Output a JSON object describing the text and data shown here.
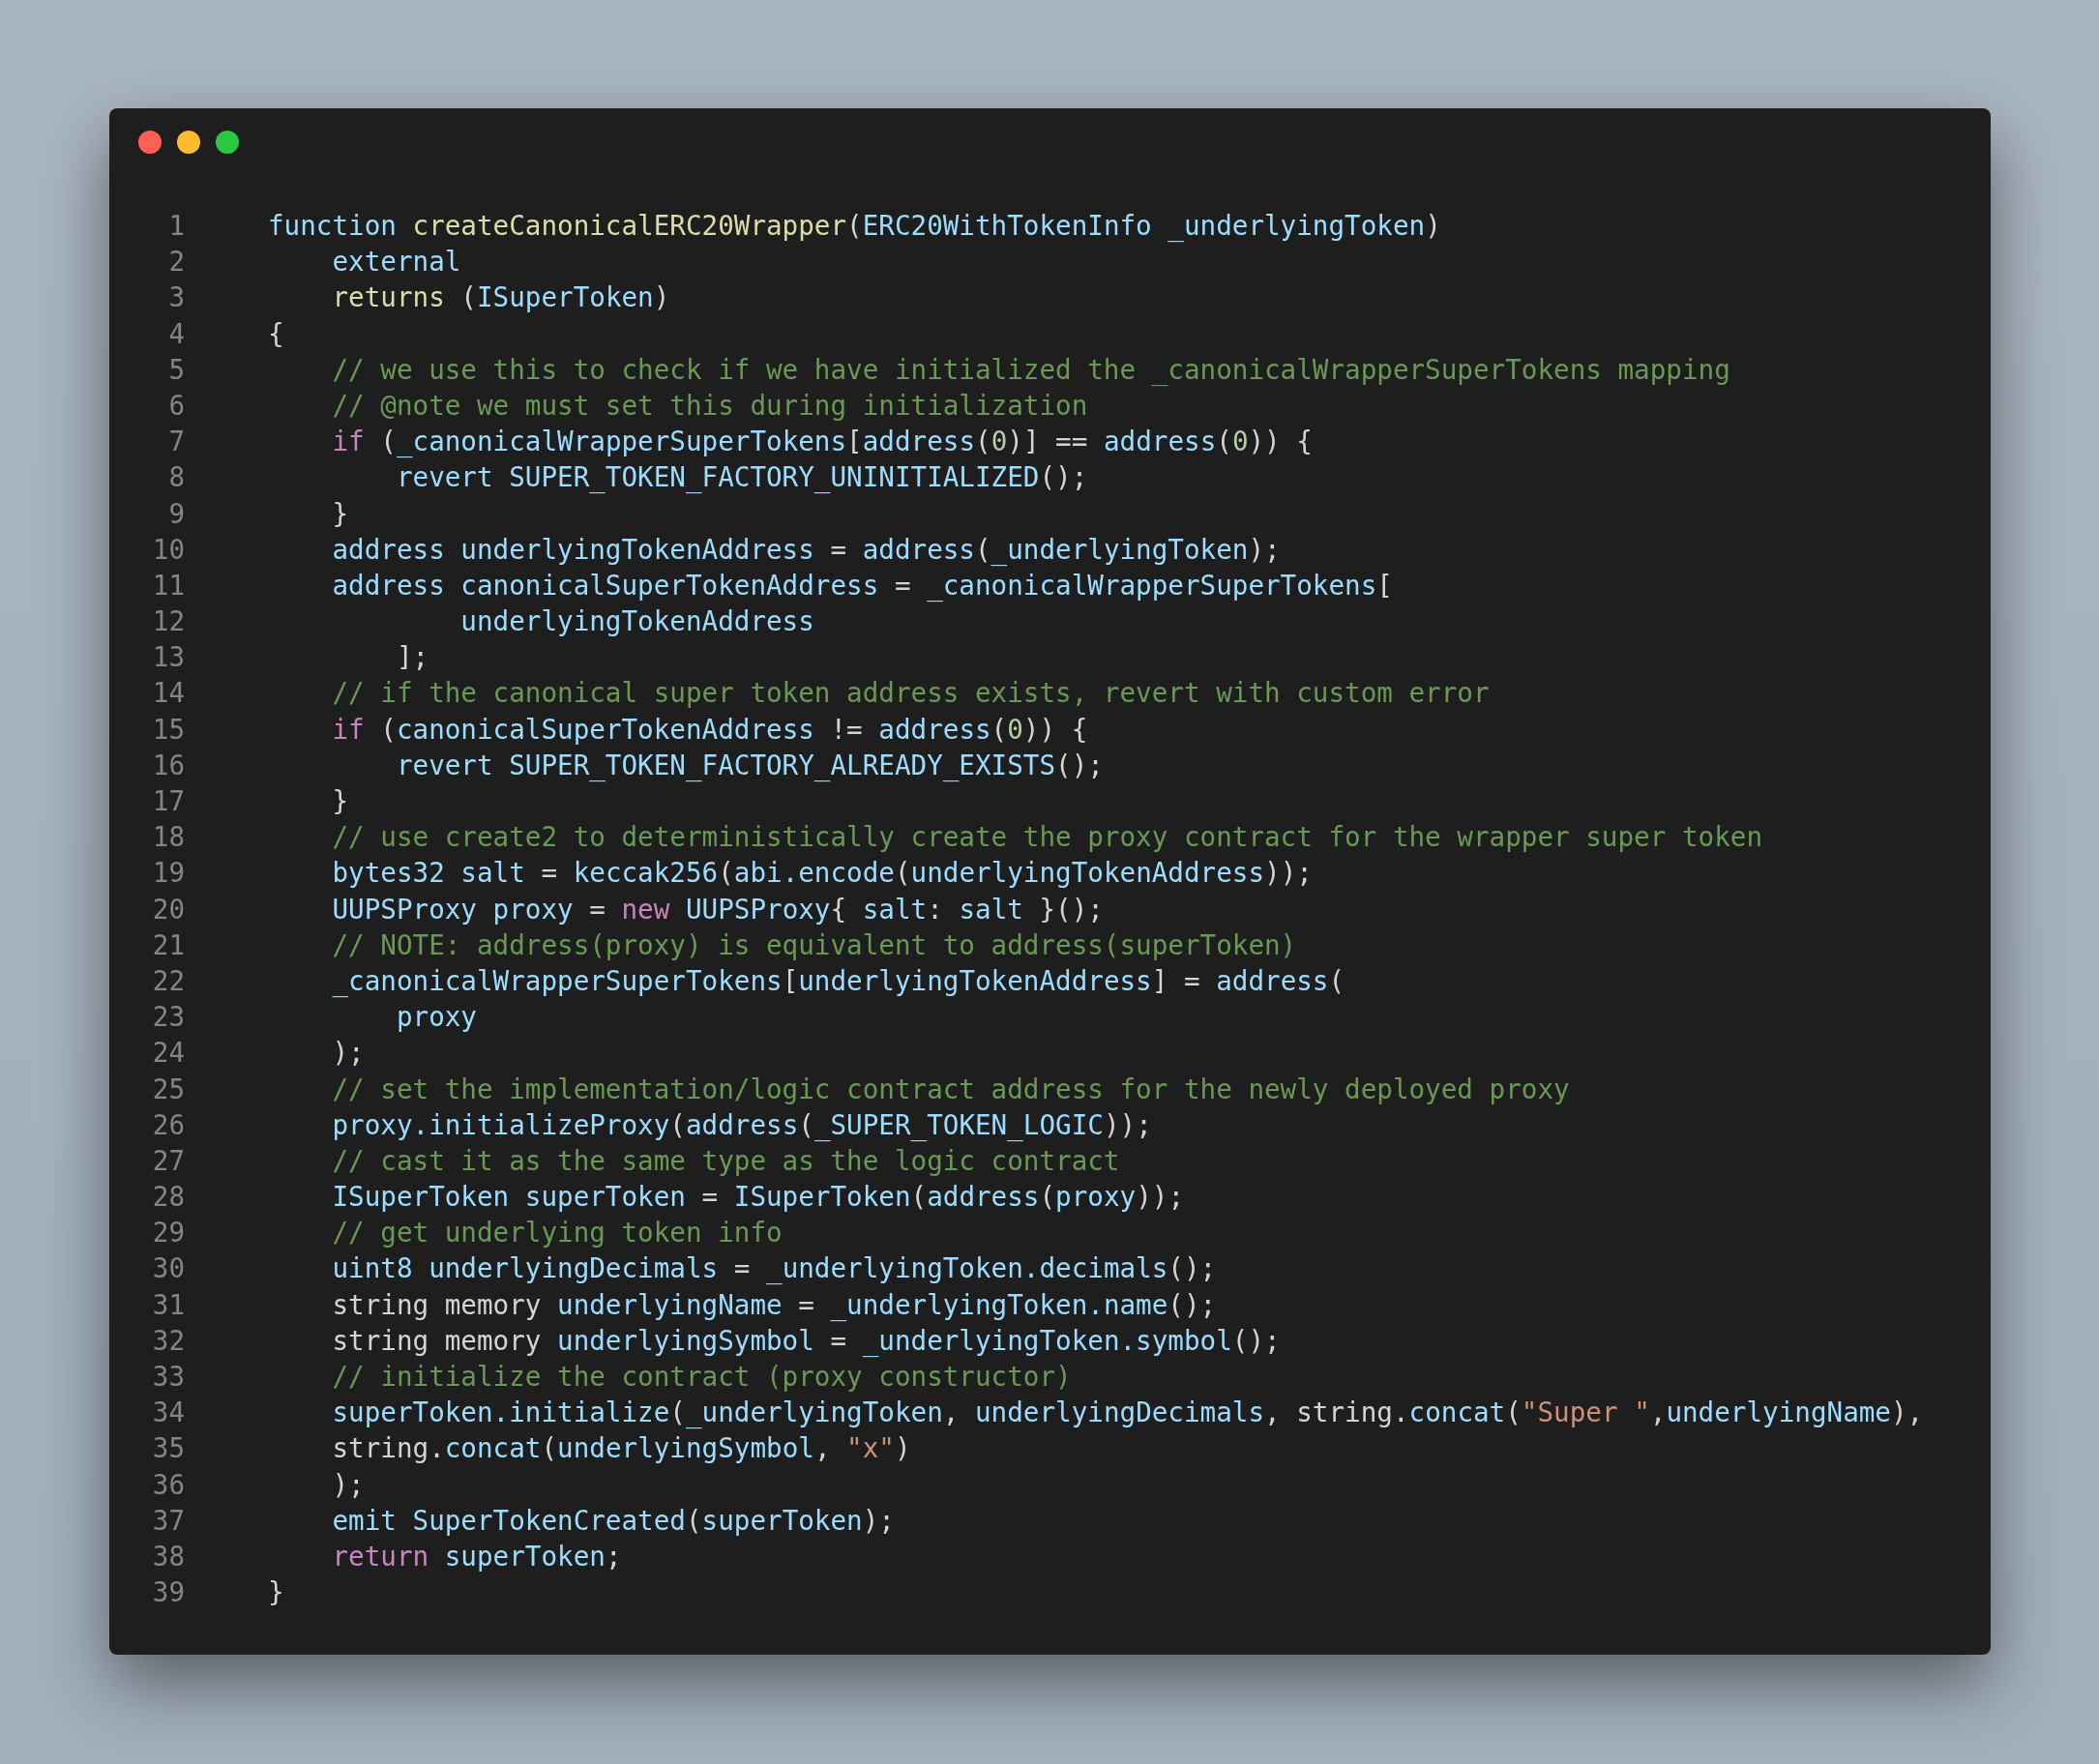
{
  "window": {
    "controls": [
      {
        "kind": "close"
      },
      {
        "kind": "minimize"
      },
      {
        "kind": "maximize"
      }
    ]
  },
  "lines": [
    {
      "number": "1",
      "tokens": [
        {
          "text": "function ",
          "kind": "ident"
        },
        {
          "text": "createCanonicalERC20Wrapper",
          "kind": "func"
        },
        {
          "text": "(",
          "kind": "plain"
        },
        {
          "text": "ERC20WithTokenInfo _underlyingToken",
          "kind": "ident"
        },
        {
          "text": ")",
          "kind": "plain"
        }
      ]
    },
    {
      "number": "2",
      "tokens": [
        {
          "text": "    external",
          "kind": "ident"
        }
      ]
    },
    {
      "number": "3",
      "tokens": [
        {
          "text": "    returns",
          "kind": "func"
        },
        {
          "text": " (",
          "kind": "plain"
        },
        {
          "text": "ISuperToken",
          "kind": "ident"
        },
        {
          "text": ")",
          "kind": "plain"
        }
      ]
    },
    {
      "number": "4",
      "tokens": [
        {
          "text": "{",
          "kind": "plain"
        }
      ]
    },
    {
      "number": "5",
      "tokens": [
        {
          "text": "    // we use this to check if we have initialized the _canonicalWrapperSuperTokens mapping",
          "kind": "comment"
        }
      ]
    },
    {
      "number": "6",
      "tokens": [
        {
          "text": "    // @note we must set this during initialization",
          "kind": "comment"
        }
      ]
    },
    {
      "number": "7",
      "tokens": [
        {
          "text": "    if",
          "kind": "control"
        },
        {
          "text": " (",
          "kind": "plain"
        },
        {
          "text": "_canonicalWrapperSuperTokens",
          "kind": "ident"
        },
        {
          "text": "[",
          "kind": "plain"
        },
        {
          "text": "address",
          "kind": "ident"
        },
        {
          "text": "(",
          "kind": "plain"
        },
        {
          "text": "0",
          "kind": "number"
        },
        {
          "text": ")] == ",
          "kind": "plain"
        },
        {
          "text": "address",
          "kind": "ident"
        },
        {
          "text": "(",
          "kind": "plain"
        },
        {
          "text": "0",
          "kind": "number"
        },
        {
          "text": ")) {",
          "kind": "plain"
        }
      ]
    },
    {
      "number": "8",
      "tokens": [
        {
          "text": "        revert SUPER_TOKEN_FACTORY_UNINITIALIZED",
          "kind": "ident"
        },
        {
          "text": "();",
          "kind": "plain"
        }
      ]
    },
    {
      "number": "9",
      "tokens": [
        {
          "text": "    }",
          "kind": "plain"
        }
      ]
    },
    {
      "number": "10",
      "tokens": [
        {
          "text": "    address underlyingTokenAddress",
          "kind": "ident"
        },
        {
          "text": " = ",
          "kind": "plain"
        },
        {
          "text": "address",
          "kind": "ident"
        },
        {
          "text": "(",
          "kind": "plain"
        },
        {
          "text": "_underlyingToken",
          "kind": "ident"
        },
        {
          "text": ");",
          "kind": "plain"
        }
      ]
    },
    {
      "number": "11",
      "tokens": [
        {
          "text": "    address canonicalSuperTokenAddress",
          "kind": "ident"
        },
        {
          "text": " = ",
          "kind": "plain"
        },
        {
          "text": "_canonicalWrapperSuperTokens",
          "kind": "ident"
        },
        {
          "text": "[",
          "kind": "plain"
        }
      ]
    },
    {
      "number": "12",
      "tokens": [
        {
          "text": "            underlyingTokenAddress",
          "kind": "ident"
        }
      ]
    },
    {
      "number": "13",
      "tokens": [
        {
          "text": "        ];",
          "kind": "plain"
        }
      ]
    },
    {
      "number": "14",
      "tokens": [
        {
          "text": "    // if the canonical super token address exists, revert with custom error",
          "kind": "comment"
        }
      ]
    },
    {
      "number": "15",
      "tokens": [
        {
          "text": "    if",
          "kind": "control"
        },
        {
          "text": " (",
          "kind": "plain"
        },
        {
          "text": "canonicalSuperTokenAddress",
          "kind": "ident"
        },
        {
          "text": " != ",
          "kind": "plain"
        },
        {
          "text": "address",
          "kind": "ident"
        },
        {
          "text": "(",
          "kind": "plain"
        },
        {
          "text": "0",
          "kind": "number"
        },
        {
          "text": ")) {",
          "kind": "plain"
        }
      ]
    },
    {
      "number": "16",
      "tokens": [
        {
          "text": "        revert SUPER_TOKEN_FACTORY_ALREADY_EXISTS",
          "kind": "ident"
        },
        {
          "text": "();",
          "kind": "plain"
        }
      ]
    },
    {
      "number": "17",
      "tokens": [
        {
          "text": "    }",
          "kind": "plain"
        }
      ]
    },
    {
      "number": "18",
      "tokens": [
        {
          "text": "    // use create2 to deterministically create the proxy contract for the wrapper super token",
          "kind": "comment"
        }
      ]
    },
    {
      "number": "19",
      "tokens": [
        {
          "text": "    bytes32 salt",
          "kind": "ident"
        },
        {
          "text": " = ",
          "kind": "plain"
        },
        {
          "text": "keccak256",
          "kind": "ident"
        },
        {
          "text": "(",
          "kind": "plain"
        },
        {
          "text": "abi.encode",
          "kind": "ident"
        },
        {
          "text": "(",
          "kind": "plain"
        },
        {
          "text": "underlyingTokenAddress",
          "kind": "ident"
        },
        {
          "text": "));",
          "kind": "plain"
        }
      ]
    },
    {
      "number": "20",
      "tokens": [
        {
          "text": "    UUPSProxy proxy",
          "kind": "ident"
        },
        {
          "text": " = ",
          "kind": "plain"
        },
        {
          "text": "new",
          "kind": "control"
        },
        {
          "text": " UUPSProxy",
          "kind": "ident"
        },
        {
          "text": "{ ",
          "kind": "plain"
        },
        {
          "text": "salt",
          "kind": "ident"
        },
        {
          "text": ": ",
          "kind": "plain"
        },
        {
          "text": "salt",
          "kind": "ident"
        },
        {
          "text": " }();",
          "kind": "plain"
        }
      ]
    },
    {
      "number": "21",
      "tokens": [
        {
          "text": "    // NOTE: address(proxy) is equivalent to address(superToken)",
          "kind": "comment"
        }
      ]
    },
    {
      "number": "22",
      "tokens": [
        {
          "text": "    _canonicalWrapperSuperTokens",
          "kind": "ident"
        },
        {
          "text": "[",
          "kind": "plain"
        },
        {
          "text": "underlyingTokenAddress",
          "kind": "ident"
        },
        {
          "text": "] = ",
          "kind": "plain"
        },
        {
          "text": "address",
          "kind": "ident"
        },
        {
          "text": "(",
          "kind": "plain"
        }
      ]
    },
    {
      "number": "23",
      "tokens": [
        {
          "text": "        proxy",
          "kind": "ident"
        }
      ]
    },
    {
      "number": "24",
      "tokens": [
        {
          "text": "    );",
          "kind": "plain"
        }
      ]
    },
    {
      "number": "25",
      "tokens": [
        {
          "text": "    // set the implementation/logic contract address for the newly deployed proxy",
          "kind": "comment"
        }
      ]
    },
    {
      "number": "26",
      "tokens": [
        {
          "text": "    proxy.initializeProxy",
          "kind": "ident"
        },
        {
          "text": "(",
          "kind": "plain"
        },
        {
          "text": "address",
          "kind": "ident"
        },
        {
          "text": "(",
          "kind": "plain"
        },
        {
          "text": "_SUPER_TOKEN_LOGIC",
          "kind": "ident"
        },
        {
          "text": "));",
          "kind": "plain"
        }
      ]
    },
    {
      "number": "27",
      "tokens": [
        {
          "text": "    // cast it as the same type as the logic contract",
          "kind": "comment"
        }
      ]
    },
    {
      "number": "28",
      "tokens": [
        {
          "text": "    ISuperToken superToken",
          "kind": "ident"
        },
        {
          "text": " = ",
          "kind": "plain"
        },
        {
          "text": "ISuperToken",
          "kind": "ident"
        },
        {
          "text": "(",
          "kind": "plain"
        },
        {
          "text": "address",
          "kind": "ident"
        },
        {
          "text": "(",
          "kind": "plain"
        },
        {
          "text": "proxy",
          "kind": "ident"
        },
        {
          "text": "));",
          "kind": "plain"
        }
      ]
    },
    {
      "number": "29",
      "tokens": [
        {
          "text": "    // get underlying token info",
          "kind": "comment"
        }
      ]
    },
    {
      "number": "30",
      "tokens": [
        {
          "text": "    uint8 underlyingDecimals",
          "kind": "ident"
        },
        {
          "text": " = ",
          "kind": "plain"
        },
        {
          "text": "_underlyingToken.decimals",
          "kind": "ident"
        },
        {
          "text": "();",
          "kind": "plain"
        }
      ]
    },
    {
      "number": "31",
      "tokens": [
        {
          "text": "    string memory ",
          "kind": "plain"
        },
        {
          "text": "underlyingName",
          "kind": "ident"
        },
        {
          "text": " = ",
          "kind": "plain"
        },
        {
          "text": "_underlyingToken.name",
          "kind": "ident"
        },
        {
          "text": "();",
          "kind": "plain"
        }
      ]
    },
    {
      "number": "32",
      "tokens": [
        {
          "text": "    string memory ",
          "kind": "plain"
        },
        {
          "text": "underlyingSymbol",
          "kind": "ident"
        },
        {
          "text": " = ",
          "kind": "plain"
        },
        {
          "text": "_underlyingToken.symbol",
          "kind": "ident"
        },
        {
          "text": "();",
          "kind": "plain"
        }
      ]
    },
    {
      "number": "33",
      "tokens": [
        {
          "text": "    // initialize the contract (proxy constructor)",
          "kind": "comment"
        }
      ]
    },
    {
      "number": "34",
      "tokens": [
        {
          "text": "    superToken.initialize",
          "kind": "ident"
        },
        {
          "text": "(",
          "kind": "plain"
        },
        {
          "text": "_underlyingToken",
          "kind": "ident"
        },
        {
          "text": ", ",
          "kind": "plain"
        },
        {
          "text": "underlyingDecimals",
          "kind": "ident"
        },
        {
          "text": ", string.",
          "kind": "plain"
        },
        {
          "text": "concat",
          "kind": "ident"
        },
        {
          "text": "(",
          "kind": "plain"
        },
        {
          "text": "\"Super \"",
          "kind": "string"
        },
        {
          "text": ",",
          "kind": "plain"
        },
        {
          "text": "underlyingName",
          "kind": "ident"
        },
        {
          "text": "),",
          "kind": "plain"
        }
      ]
    },
    {
      "number": "35",
      "tokens": [
        {
          "text": "    string.",
          "kind": "plain"
        },
        {
          "text": "concat",
          "kind": "ident"
        },
        {
          "text": "(",
          "kind": "plain"
        },
        {
          "text": "underlyingSymbol",
          "kind": "ident"
        },
        {
          "text": ", ",
          "kind": "plain"
        },
        {
          "text": "\"x\"",
          "kind": "string"
        },
        {
          "text": ")",
          "kind": "plain"
        }
      ]
    },
    {
      "number": "36",
      "tokens": [
        {
          "text": "    );",
          "kind": "plain"
        }
      ]
    },
    {
      "number": "37",
      "tokens": [
        {
          "text": "    emit SuperTokenCreated",
          "kind": "ident"
        },
        {
          "text": "(",
          "kind": "plain"
        },
        {
          "text": "superToken",
          "kind": "ident"
        },
        {
          "text": ");",
          "kind": "plain"
        }
      ]
    },
    {
      "number": "38",
      "tokens": [
        {
          "text": "    return",
          "kind": "control"
        },
        {
          "text": " superToken",
          "kind": "ident"
        },
        {
          "text": ";",
          "kind": "plain"
        }
      ]
    },
    {
      "number": "39",
      "tokens": [
        {
          "text": "}",
          "kind": "plain"
        }
      ]
    }
  ]
}
